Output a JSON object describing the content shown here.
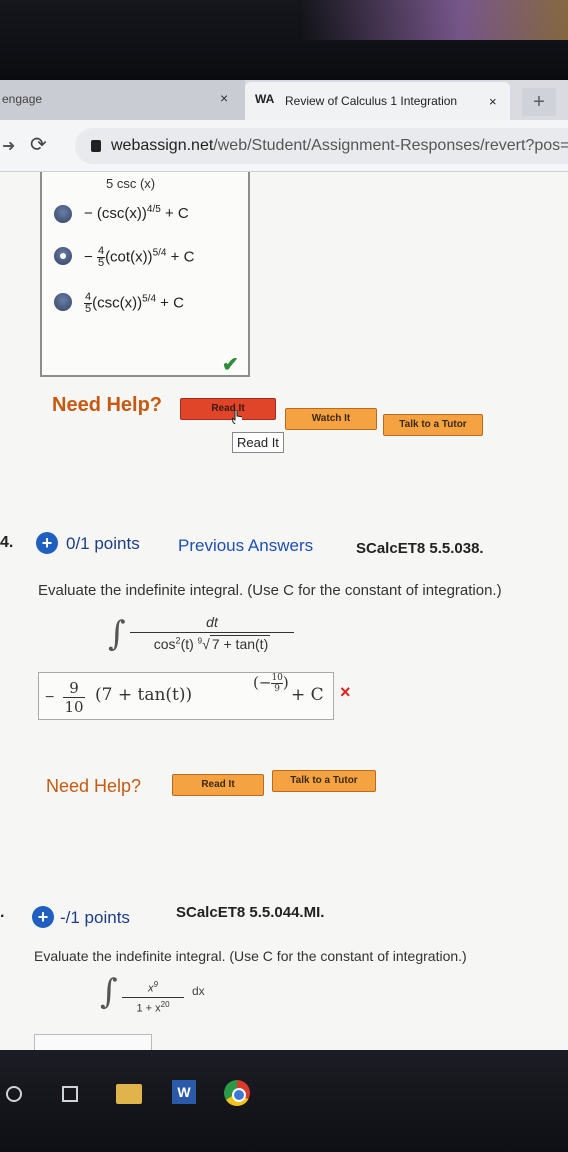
{
  "browser": {
    "inactive_tab_label": "engage",
    "inactive_tab_close": "×",
    "active_tab_title": "Review of Calculus 1 Integration",
    "active_tab_close": "×",
    "new_tab": "+",
    "url_host": "webassign.net",
    "url_path": "/web/Student/Assignment-Responses/revert?pos="
  },
  "prev_question": {
    "cut_text": "5    csc (x)",
    "choices": [
      {
        "prefix": "− (csc(x))",
        "power": "4/5",
        "suffix": " + C",
        "selected": false
      },
      {
        "prefix": "− ",
        "coef_num": "4",
        "coef_den": "5",
        "body": "(cot(x))",
        "power": "5/4",
        "suffix": " + C",
        "selected": true
      },
      {
        "prefix": "",
        "coef_num": "4",
        "coef_den": "5",
        "body": "(csc(x))",
        "power": "5/4",
        "suffix": " + C",
        "selected": false
      }
    ],
    "need_help": "Need Help?",
    "read_it": "Read It",
    "watch_it": "Watch It",
    "talk_to_tutor": "Talk to a Tutor",
    "tooltip": "Read It"
  },
  "question4": {
    "number": "4.",
    "points": "0/1 points",
    "previous_answers": "Previous Answers",
    "id": "SCalcET8 5.5.038.",
    "prompt": "Evaluate the indefinite integral. (Use C for the constant of integration.)",
    "integrand_num": "dt",
    "integrand_den_a": "cos",
    "integrand_den_sup": "2",
    "integrand_den_b": "(t) ",
    "root_index": "9",
    "root_body": "7 + tan(t)",
    "answer_coef_num": "9",
    "answer_coef_den": "10",
    "answer_body": "(7 + tan(t))",
    "answer_exp_sign": "−",
    "answer_exp_num": "10",
    "answer_exp_den": "9",
    "answer_plus_c": "+ C",
    "status_mark": "×",
    "need_help": "Need Help?",
    "read_it": "Read It",
    "talk_to_tutor": "Talk to a Tutor"
  },
  "question5": {
    "number": ".",
    "points": "-/1 points",
    "id": "SCalcET8 5.5.044.MI.",
    "prompt": "Evaluate the indefinite integral. (Use C for the constant of integration.)",
    "integrand_num": "x",
    "integrand_num_sup": "9",
    "integrand_den": "1 + x",
    "integrand_den_sup": "20",
    "dx": "dx"
  },
  "taskbar": {
    "word_letter": "W"
  },
  "colors": {
    "need_help_orange": "#c65a12",
    "button_orange": "#f5a342",
    "button_red": "#e0452a",
    "link_blue": "#1e4fb3",
    "correct_green": "#2f8a3a",
    "wrong_red": "#dd2222"
  },
  "icons": [
    "reload-icon",
    "lock-icon",
    "plus-circle-icon",
    "check-icon",
    "x-icon",
    "search-icon",
    "task-view-icon",
    "file-explorer-icon",
    "word-icon",
    "chrome-icon"
  ]
}
